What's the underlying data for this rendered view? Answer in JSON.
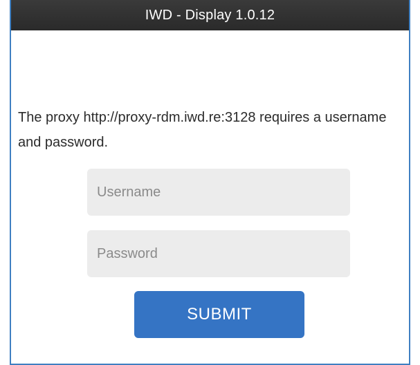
{
  "window": {
    "title": "IWD - Display 1.0.12"
  },
  "auth": {
    "message": "The proxy http://proxy-rdm.iwd.re:3128 requires a username and password.",
    "username": {
      "placeholder": "Username",
      "value": ""
    },
    "password": {
      "placeholder": "Password",
      "value": ""
    },
    "submit_label": "SUBMIT"
  },
  "colors": {
    "titlebar": "#2f2f2f",
    "window_border": "#3f7fc1",
    "input_background": "#ececec",
    "button": "#3574c4",
    "button_text": "#ffffff"
  }
}
